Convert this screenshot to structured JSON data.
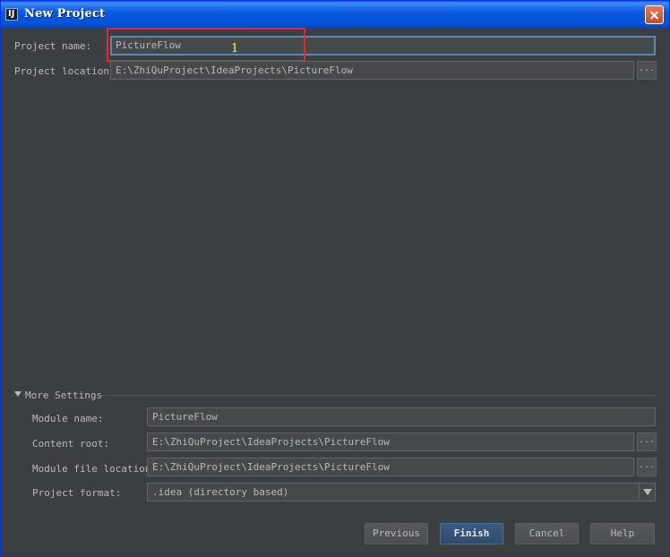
{
  "window": {
    "title": "New Project"
  },
  "form": {
    "project_name_label": "Project name:",
    "project_name_value": "PictureFlow",
    "project_location_label": "Project location:",
    "project_location_value": "E:\\ZhiQuProject\\IdeaProjects\\PictureFlow",
    "browse_label": "..."
  },
  "annotation": {
    "marker": "1",
    "color": "#e8282b"
  },
  "more_settings": {
    "header": "More Settings",
    "module_name_label": "Module name:",
    "module_name_value": "PictureFlow",
    "content_root_label": "Content root:",
    "content_root_value": "E:\\ZhiQuProject\\IdeaProjects\\PictureFlow",
    "module_file_location_label": "Module file location:",
    "module_file_location_value": "E:\\ZhiQuProject\\IdeaProjects\\PictureFlow",
    "project_format_label": "Project format:",
    "project_format_value": ".idea (directory based)"
  },
  "buttons": {
    "previous": "Previous",
    "finish": "Finish",
    "cancel": "Cancel",
    "help": "Help"
  },
  "colors": {
    "background": "#3c3f41",
    "field": "#45494a",
    "accent": "#5a86b8",
    "text": "#bbbbbb"
  },
  "icons": [
    "intellij-app-icon",
    "close-icon",
    "ellipsis-icon",
    "triangle-down-icon",
    "chevron-down-icon"
  ]
}
